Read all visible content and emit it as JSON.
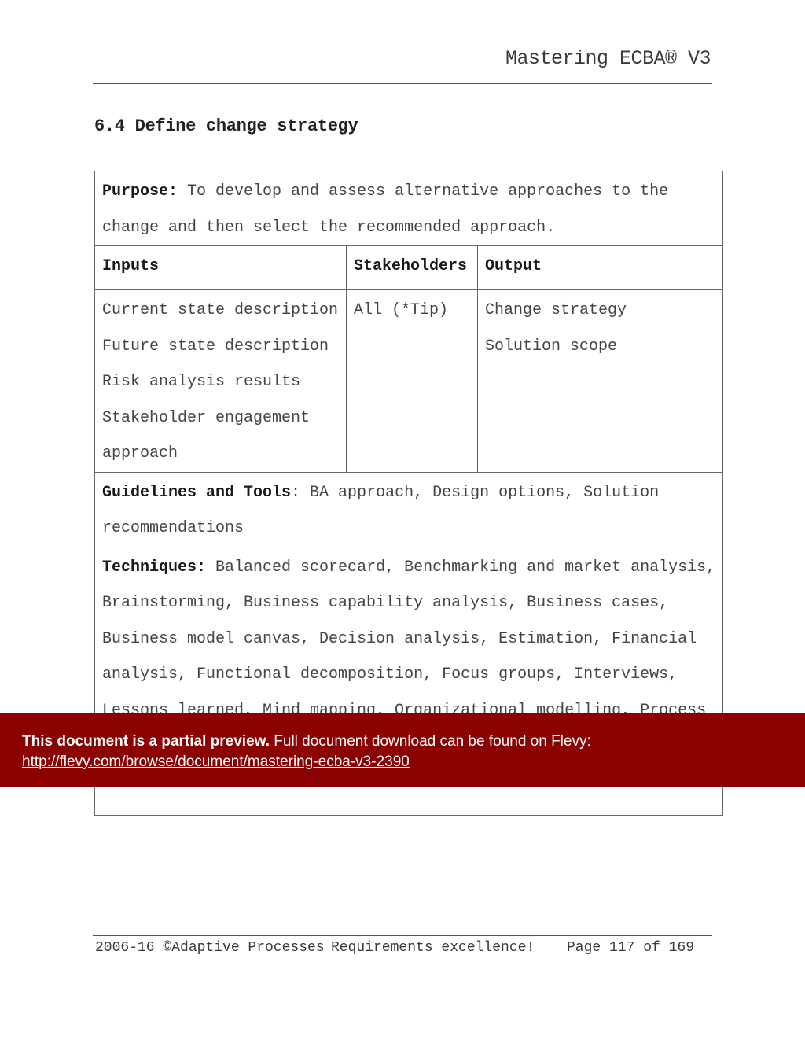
{
  "header": {
    "running_title": "Mastering ECBA® V3"
  },
  "section": {
    "title": "6.4 Define change strategy"
  },
  "table": {
    "purpose": {
      "label": "Purpose:",
      "line1": " To develop and assess alternative approaches to the",
      "line2": "change and then select the recommended approach."
    },
    "columns": [
      "Inputs",
      "Stakeholders",
      "Output"
    ],
    "inputs": [
      "Current state description",
      "Future state description",
      "Risk analysis results",
      "Stakeholder engagement",
      "approach"
    ],
    "stakeholders": [
      "All (*Tip)"
    ],
    "outputs": [
      "Change strategy",
      "Solution scope"
    ],
    "guidelines": {
      "label": "Guidelines and Tools",
      "line1": ": BA approach, Design options, Solution",
      "line2": "recommendations"
    },
    "techniques": {
      "label": "Techniques:",
      "lines": [
        " Balanced scorecard, Benchmarking and market analysis,",
        "Brainstorming, Business capability analysis, Business cases,",
        "Business model canvas, Decision analysis,  Estimation, Financial",
        "analysis, Functional decomposition, Focus groups, Interviews,",
        "Lessons learned, Mind mapping, Organizational modelling, Process"
      ]
    }
  },
  "banner": {
    "bold_text": "This document is a partial preview.",
    "text": "  Full document download can be found on Flevy:",
    "link_text": "http://flevy.com/browse/document/mastering-ecba-v3-2390",
    "background_color": "#8b0000"
  },
  "footer": {
    "copyright": "2006-16 ©Adaptive Processes",
    "tagline": "Requirements excellence!",
    "page": "Page 117 of 169"
  }
}
